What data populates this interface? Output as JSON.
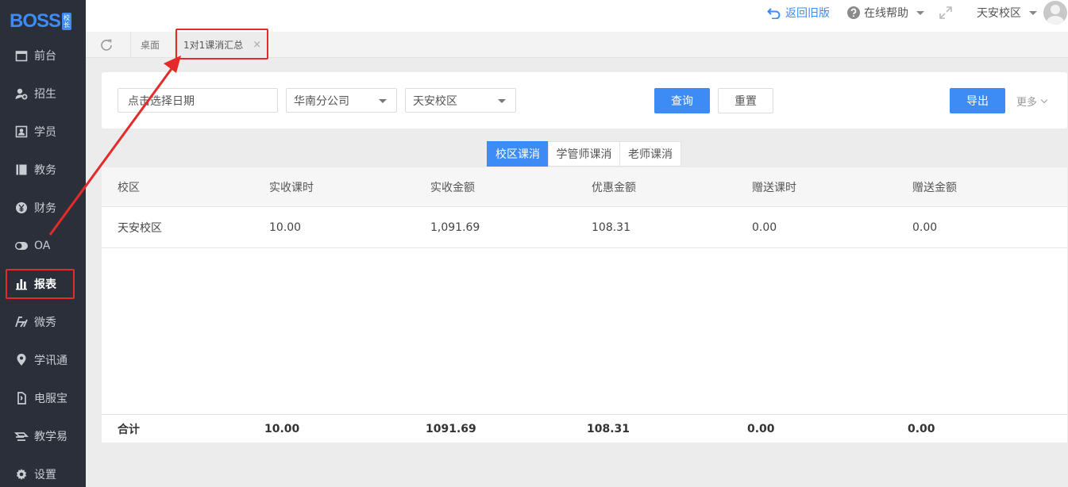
{
  "app": {
    "logo_text": "BOSS",
    "logo_badge": "校长",
    "accent_color": "#3d8cf5",
    "sidebar_color": "#2b2f3a",
    "annotation_color": "#e52a2a"
  },
  "sidebar": {
    "items": [
      {
        "label": "前台",
        "icon": "calendar-icon"
      },
      {
        "label": "招生",
        "icon": "user-add-icon"
      },
      {
        "label": "学员",
        "icon": "id-card-icon"
      },
      {
        "label": "教务",
        "icon": "book-icon"
      },
      {
        "label": "财务",
        "icon": "yen-icon"
      },
      {
        "label": "OA",
        "icon": "toggle-icon"
      },
      {
        "label": "报表",
        "icon": "bar-chart-icon",
        "active": true
      },
      {
        "label": "微秀",
        "icon": "show-icon"
      },
      {
        "label": "学讯通",
        "icon": "location-pin-icon"
      },
      {
        "label": "电服宝",
        "icon": "phone-icon"
      },
      {
        "label": "教学易",
        "icon": "teach-icon"
      },
      {
        "label": "设置",
        "icon": "gear-icon"
      }
    ]
  },
  "topbar": {
    "back_label": "返回旧版",
    "help_label": "在线帮助",
    "campus_label": "天安校区"
  },
  "tabs": {
    "desktop_label": "桌面",
    "active_label": "1对1课消汇总",
    "close_glyph": "×"
  },
  "filters": {
    "date_placeholder": "点击选择日期",
    "company_value": "华南分公司",
    "campus_value": "天安校区",
    "query_label": "查询",
    "reset_label": "重置",
    "export_label": "导出",
    "more_label": "更多"
  },
  "segments": [
    "校区课消",
    "学管师课消",
    "老师课消"
  ],
  "table": {
    "headers": [
      "校区",
      "实收课时",
      "实收金额",
      "优惠金额",
      "赠送课时",
      "赠送金额"
    ],
    "rows": [
      [
        "天安校区",
        "10.00",
        "1,091.69",
        "108.31",
        "0.00",
        "0.00"
      ]
    ],
    "footer": [
      "合计",
      "10.00",
      "1091.69",
      "108.31",
      "0.00",
      "0.00"
    ]
  }
}
